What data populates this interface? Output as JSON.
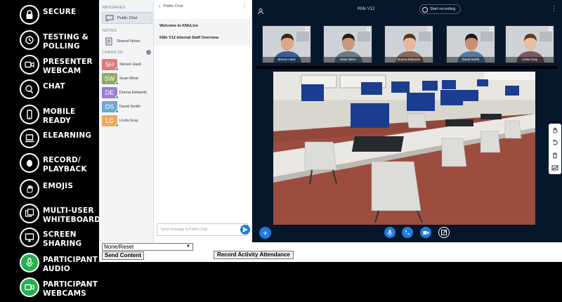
{
  "features": [
    {
      "label": "SECURE",
      "icon": "lock-icon",
      "green": false
    },
    {
      "label": "TESTING & POLLING",
      "icon": "poll-icon",
      "green": false
    },
    {
      "label": "PRESENTER WEBCAM",
      "icon": "video-camera-icon",
      "green": false
    },
    {
      "label": "CHAT",
      "icon": "chat-bubbles-icon",
      "green": false
    },
    {
      "label": "MOBILE READY",
      "icon": "mobile-phone-icon",
      "green": false
    },
    {
      "label": "ELEARNING",
      "icon": "laptop-icon",
      "green": false
    },
    {
      "label": "RECORD/ PLAYBACK",
      "icon": "record-icon",
      "green": false
    },
    {
      "label": "EMOJIS",
      "icon": "hand-icon",
      "green": false
    },
    {
      "label": "MULTI-USER WHITEBOARD",
      "icon": "whiteboard-icon",
      "green": false
    },
    {
      "label": "SCREEN SHARING",
      "icon": "monitor-icon",
      "green": false
    },
    {
      "label": "PARTICIPANT AUDIO",
      "icon": "microphone-icon",
      "green": true
    },
    {
      "label": "PARTICIPANT WEBCAMS",
      "icon": "video-camera-icon",
      "green": true
    }
  ],
  "sidebar": {
    "messages_header": "MESSAGES",
    "public_chat": "Public Chat",
    "notes_header": "NOTES",
    "shared_notes": "Shared Notes",
    "users_header": "USERS (5)",
    "users": [
      {
        "initials": "SH",
        "name": "Steven Hack",
        "color": "#e07a7a"
      },
      {
        "initials": "SW",
        "name": "Sean West",
        "color": "#8fa96a"
      },
      {
        "initials": "DE",
        "name": "Donna Edwards",
        "color": "#9b7ed6"
      },
      {
        "initials": "DS",
        "name": "David Smith",
        "color": "#6fa6d6"
      },
      {
        "initials": "LG",
        "name": "Linda Gray",
        "color": "#f2a65a"
      }
    ]
  },
  "chat": {
    "title": "Public Chat",
    "messages": [
      "Welcome to KMxLive",
      "KMx V12 Internal Staff Overview"
    ],
    "placeholder": "Send message to Public Chat"
  },
  "stage": {
    "title": "KMx V12",
    "record_label": "Start recording",
    "cams": [
      "Steven Hack",
      "Sean West",
      "Donna Edwards",
      "David Smith",
      "Linda Gray"
    ]
  },
  "bottom": {
    "select_value": "None/Reset",
    "send_content": "Send Content",
    "attendance": "Record Activity Attendance"
  },
  "colors": {
    "accent": "#1f7be0",
    "green": "#27ae4f",
    "stage_bg": "#06172c"
  }
}
